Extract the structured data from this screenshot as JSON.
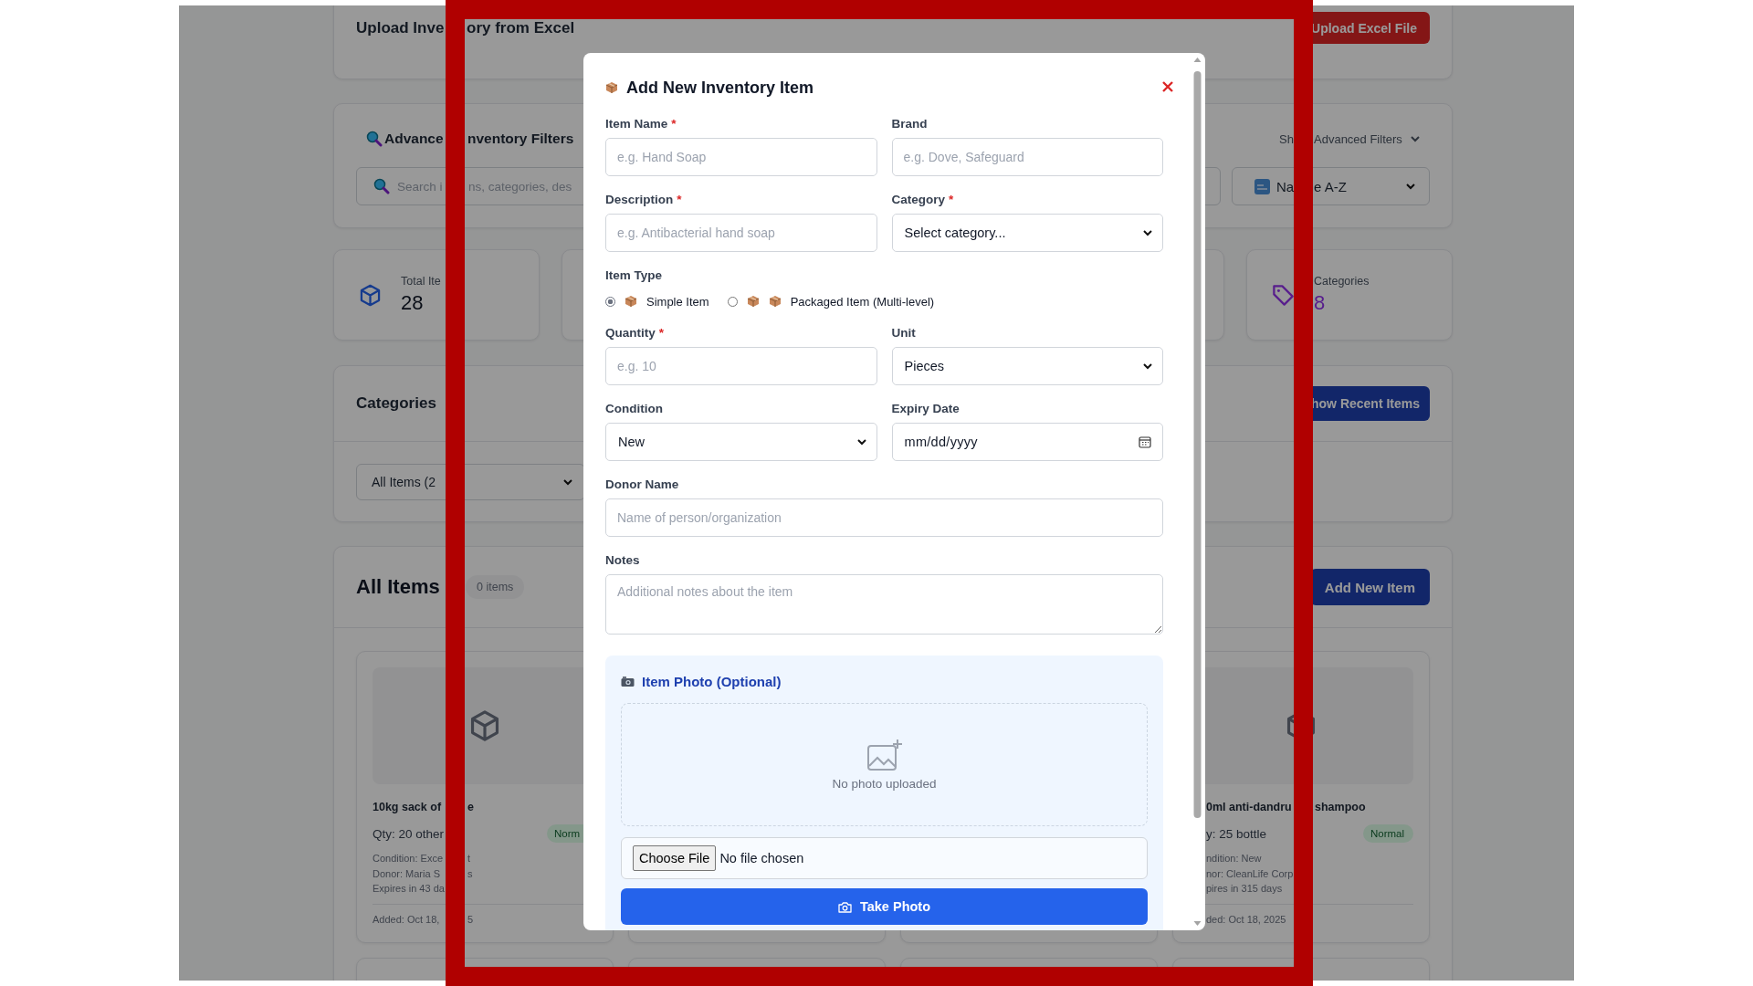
{
  "background": {
    "upload_card": {
      "title_parts": [
        "Upload Inve",
        "ory from Excel"
      ],
      "button": "Upload Excel File"
    },
    "filters_card": {
      "title_parts": [
        "Advance",
        "nventory Filters"
      ],
      "search_parts": [
        "Search i",
        "ns, categories, des"
      ],
      "toggle_parts": [
        "Sh",
        "Advanced Filters"
      ],
      "sort_parts": [
        "Na",
        "e A-Z"
      ]
    },
    "stats": [
      {
        "kind": "cube",
        "label": "Total Ite",
        "value": "28"
      },
      {
        "kind": "tag",
        "label": "Categories",
        "value": "8"
      }
    ],
    "categories_card": {
      "title": "Categories",
      "button": "how Recent Items",
      "select": "All Items (2"
    },
    "items_card": {
      "title": "All Items",
      "count": "0 items",
      "button": "Add New Item",
      "items": [
        {
          "name_parts": [
            "10kg sack of",
            "e"
          ],
          "qty": "Qty: 20 other",
          "status": "Norm",
          "details": [
            [
              "Condition: Exce",
              "t"
            ],
            [
              "Donor: Maria S",
              "s"
            ],
            [
              "Expires in 43 da"
            ]
          ],
          "added_parts": [
            "Added: Oct 18,",
            "5"
          ]
        },
        {
          "name_parts": [
            "0ml anti-dandru",
            "shampoo"
          ],
          "qty": "y: 25 bottle",
          "status": "Normal",
          "details": [
            [
              "ndition: New"
            ],
            [
              "nor: CleanLife Corp"
            ],
            [
              "pires in 315 days"
            ]
          ],
          "added_parts": [
            "ded: Oct 18, 2025"
          ]
        }
      ]
    }
  },
  "modal": {
    "title": "Add New Inventory Item",
    "fields": [
      {
        "kind": "text",
        "label": "Item Name",
        "required_mark": "*",
        "placeholder": "e.g. Hand Soap"
      },
      {
        "kind": "text",
        "label": "Brand",
        "placeholder": "e.g. Dove, Safeguard"
      },
      {
        "kind": "text",
        "label": "Description",
        "required_mark": "*",
        "placeholder": "e.g. Antibacterial hand soap"
      },
      {
        "kind": "select",
        "label": "Category",
        "required_mark": "*",
        "value": "Select category..."
      },
      {
        "kind": "radio",
        "label": "Item Type",
        "options": [
          {
            "kind": "single",
            "label": "Simple Item",
            "selected": true
          },
          {
            "kind": "multi",
            "label": "Packaged Item (Multi-level)",
            "selected": false
          }
        ]
      },
      {
        "kind": "text",
        "label": "Quantity",
        "required_mark": "*",
        "placeholder": "e.g. 10"
      },
      {
        "kind": "select",
        "label": "Unit",
        "value": "Pieces"
      },
      {
        "kind": "select",
        "label": "Condition",
        "value": "New"
      },
      {
        "kind": "date",
        "label": "Expiry Date",
        "value": "mm/dd/yyyy"
      },
      {
        "kind": "longtext",
        "label": "Donor Name",
        "placeholder": "Name of person/organization"
      },
      {
        "kind": "textarea",
        "label": "Notes",
        "placeholder": "Additional notes about the item"
      }
    ],
    "photo": {
      "title": "Item Photo (Optional)",
      "empty_text": "No photo uploaded",
      "file_button": "Choose File",
      "file_status": "No file chosen",
      "take_button": "Take Photo"
    }
  }
}
